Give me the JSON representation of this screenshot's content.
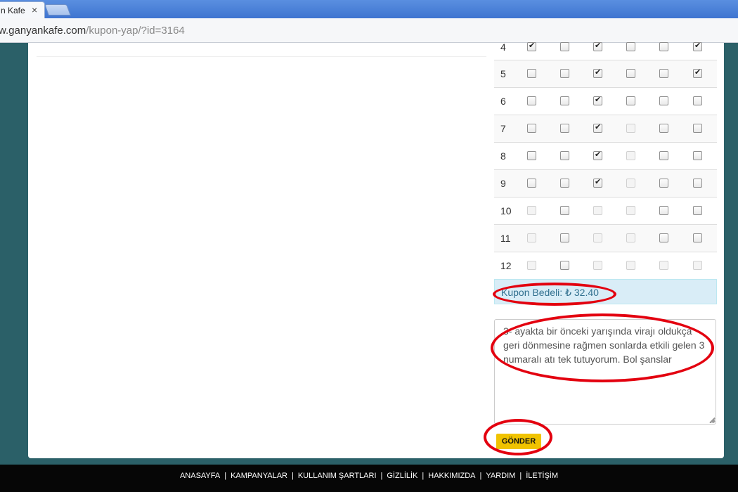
{
  "browser": {
    "tab_title": "n Kafe",
    "tab_close": "×",
    "url_host": "w.ganyankafe.com",
    "url_path": "/kupon-yap/?id=3164"
  },
  "table": {
    "rows": [
      {
        "num": "4",
        "cells": [
          "checked",
          "empty",
          "checked",
          "empty",
          "empty",
          "checked"
        ]
      },
      {
        "num": "5",
        "cells": [
          "empty",
          "empty",
          "checked",
          "empty",
          "empty",
          "checked"
        ]
      },
      {
        "num": "6",
        "cells": [
          "empty",
          "empty",
          "checked",
          "empty",
          "empty",
          "empty"
        ]
      },
      {
        "num": "7",
        "cells": [
          "empty",
          "empty",
          "checked",
          "disabled",
          "empty",
          "empty"
        ]
      },
      {
        "num": "8",
        "cells": [
          "empty",
          "empty",
          "checked",
          "disabled",
          "empty",
          "empty"
        ]
      },
      {
        "num": "9",
        "cells": [
          "empty",
          "empty",
          "checked",
          "disabled",
          "empty",
          "empty"
        ]
      },
      {
        "num": "10",
        "cells": [
          "disabled",
          "empty",
          "disabled",
          "disabled",
          "empty",
          "empty"
        ]
      },
      {
        "num": "11",
        "cells": [
          "disabled",
          "empty",
          "disabled",
          "disabled",
          "empty",
          "empty"
        ]
      },
      {
        "num": "12",
        "cells": [
          "disabled",
          "empty",
          "disabled",
          "disabled",
          "disabled",
          "disabled"
        ]
      }
    ]
  },
  "price": {
    "text": "Kupon Bedeli: ₺ 32.40"
  },
  "comment": {
    "value": "3- ayakta bir önceki yarışında virajı oldukça geri dönmesine rağmen sonlarda etkili gelen 3 numaralı atı tek tutuyorum. Bol şanslar"
  },
  "send_button": {
    "label": "GÖNDER"
  },
  "footer": {
    "links": [
      "ANASAYFA",
      "KAMPANYALAR",
      "KULLANIM ŞARTLARI",
      "GİZLİLİK",
      "HAKKIMIZDA",
      "YARDIM",
      "İLETİŞİM"
    ],
    "separator": "|"
  },
  "colors": {
    "page_bg": "#2b6068",
    "annotation": "#e3000f",
    "button": "#f0c300",
    "info_bg": "#d9edf7"
  }
}
